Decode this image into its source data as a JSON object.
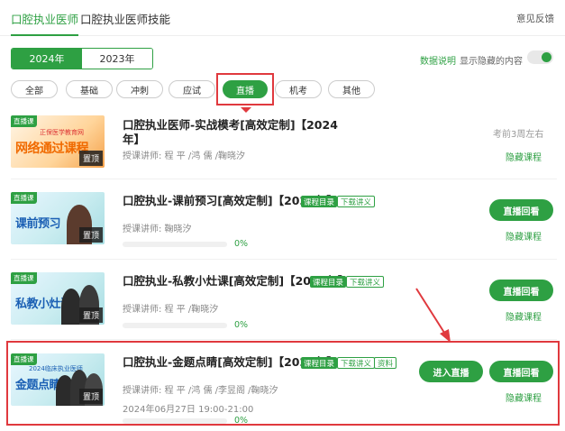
{
  "top_tabs": [
    "口腔执业医师",
    "口腔执业医师技能"
  ],
  "feedback": "意见反馈",
  "years": [
    "2024年",
    "2023年"
  ],
  "data_desc": "数据说明",
  "show_hidden": "显示隐藏的内容",
  "filters": [
    "全部",
    "基础",
    "冲刺",
    "应试",
    "直播",
    "机考",
    "其他"
  ],
  "active_filter": "直播",
  "courses": [
    {
      "thumb_tag": "直播课",
      "thumb_title": "网络通过课程",
      "thumb_logo": "正保医学教育网",
      "pin": "置顶",
      "title_line1": "口腔执业医师-实战模考[高效定制]【2024",
      "title_line2": "年】",
      "teacher": "授课讲师:  程    平 /鸿    儒 /鞠晓汐",
      "ago": "考前3周左右",
      "hide": "隐藏课程"
    },
    {
      "thumb_tag": "直播课",
      "thumb_title": "课前预习",
      "pin": "置顶",
      "title": "口腔执业-课前预习[高效定制]【2024年】",
      "tags": [
        "课程目录",
        "下载讲义"
      ],
      "teacher": "授课讲师:  鞠晓汐",
      "progress": 0,
      "pct": "0%",
      "replay": "直播回看",
      "hide": "隐藏课程"
    },
    {
      "thumb_tag": "直播课",
      "thumb_title": "私教小灶课",
      "pin": "置顶",
      "title": "口腔执业-私教小灶课[高效定制]【2024年】",
      "tags": [
        "课程目录",
        "下载讲义"
      ],
      "teacher": "授课讲师:  程    平 /鞠晓汐",
      "progress": 0,
      "pct": "0%",
      "replay": "直播回看",
      "hide": "隐藏课程"
    },
    {
      "thumb_tag": "直播课",
      "thumb_title": "金题点睛",
      "thumb_logo": "2024临床执业医师",
      "pin": "置顶",
      "title": "口腔执业-金题点睛[高效定制]【2024年】",
      "tags": [
        "课程目录",
        "下载讲义",
        "资料"
      ],
      "teacher": "授课讲师:  程    平 /鸿    儒 /李昱阁 /鞠晓汐",
      "date": "2024年06月27日 19:00-21:00",
      "progress": 0,
      "pct": "0%",
      "enter": "进入直播",
      "replay": "直播回看",
      "hide": "隐藏课程"
    }
  ],
  "colors": {
    "accent": "#2ea043",
    "highlight": "#e0393e"
  }
}
